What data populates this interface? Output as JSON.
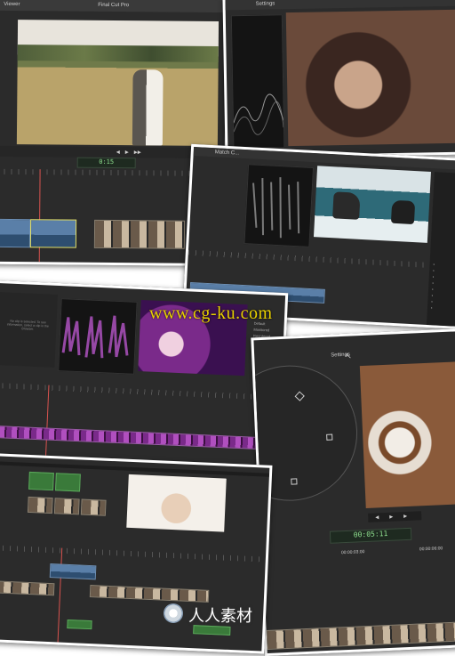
{
  "app": {
    "window_title": "Final Cut Pro",
    "viewer_label": "Viewer"
  },
  "panels": {
    "top_left": {
      "timecode": "0:15"
    },
    "top_right": {
      "title": "Settings"
    },
    "middle_right": {
      "tab_label": "Match C..."
    },
    "middle_left": {
      "scope_caption": "No clip is selected. To see information, select a clip in the Browser.",
      "options": [
        "Default",
        "Monitored",
        "Reordered",
        "Customize"
      ]
    },
    "bottom_right": {
      "title": "Settings",
      "timecode": "00:05:11",
      "ruler_labels": [
        "00:00:03:00",
        "00:00:06:00"
      ]
    },
    "bottom_left": {}
  },
  "watermark": {
    "text": "www.cg-ku.com",
    "logo_text": "人人素材",
    "logo_color": "#ffffff"
  },
  "colors": {
    "ui_dark": "#2b2b2b",
    "timecode_green": "#8fe08f",
    "playhead_red": "#d9534f",
    "watermark_yellow": "#e8d000"
  }
}
